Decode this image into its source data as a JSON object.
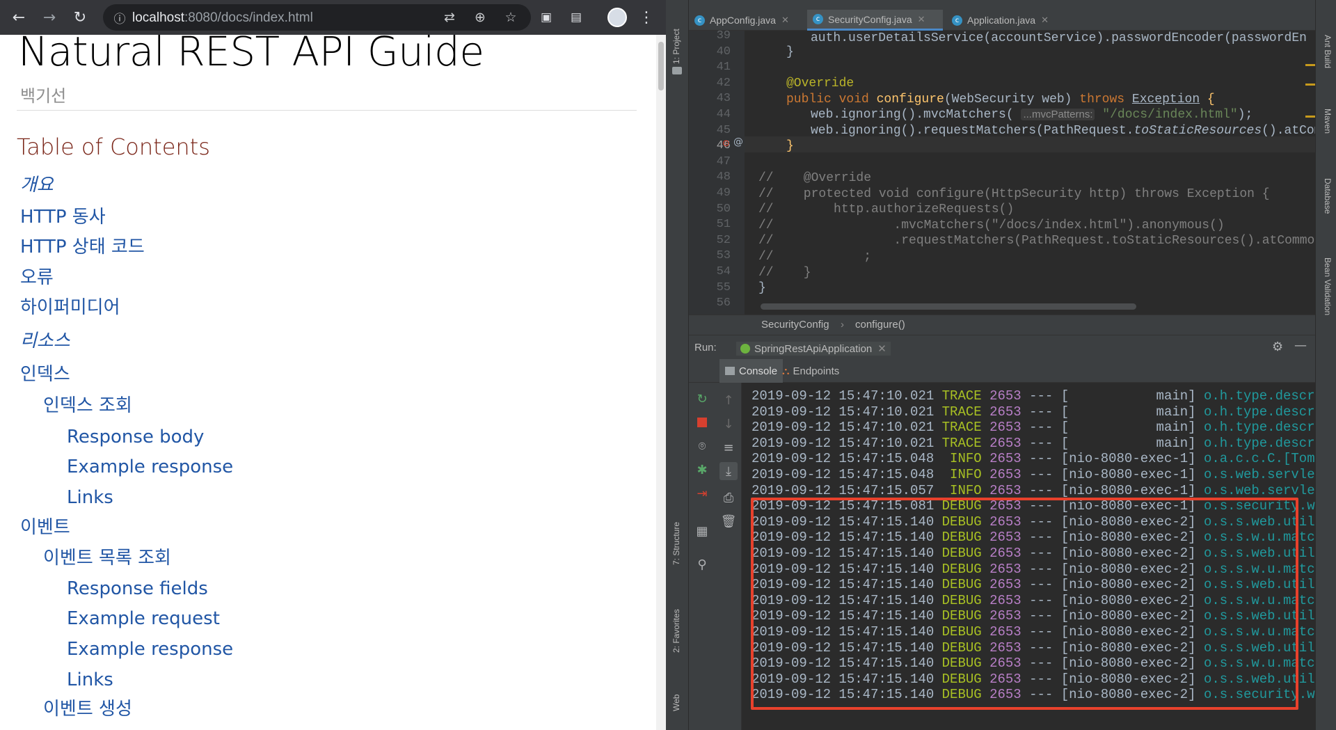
{
  "browser": {
    "url_host": "localhost",
    "url_rest": ":8080/docs/index.html",
    "doc_title": "Natural REST API Guide",
    "author": "백기선",
    "toc_title": "Table of Contents",
    "toc": [
      {
        "label": "개요",
        "level": 1,
        "italic": true
      },
      {
        "label": "HTTP 동사",
        "level": 1,
        "italic": false
      },
      {
        "label": "HTTP 상태 코드",
        "level": 1,
        "italic": false
      },
      {
        "label": "오류",
        "level": 1,
        "italic": false
      },
      {
        "label": "하이퍼미디어",
        "level": 1,
        "italic": false
      },
      {
        "label": "리소스",
        "level": 1,
        "italic": true
      },
      {
        "label": "인덱스",
        "level": 1,
        "italic": false
      },
      {
        "label": "인덱스 조회",
        "level": 2,
        "italic": false
      },
      {
        "label": "Response body",
        "level": 3,
        "italic": false
      },
      {
        "label": "Example response",
        "level": 3,
        "italic": false
      },
      {
        "label": "Links",
        "level": 3,
        "italic": false
      },
      {
        "label": "이벤트",
        "level": 1,
        "italic": false
      },
      {
        "label": "이벤트 목록 조회",
        "level": 2,
        "italic": false
      },
      {
        "label": "Response fields",
        "level": 3,
        "italic": false
      },
      {
        "label": "Example request",
        "level": 3,
        "italic": false
      },
      {
        "label": "Example response",
        "level": 3,
        "italic": false
      },
      {
        "label": "Links",
        "level": 3,
        "italic": false
      },
      {
        "label": "이벤트 생성",
        "level": 2,
        "italic": false
      }
    ]
  },
  "ide": {
    "tabs": [
      {
        "label": "AppConfig.java"
      },
      {
        "label": "SecurityConfig.java"
      },
      {
        "label": "Application.java"
      }
    ],
    "left_tools": [
      "1: Project",
      "7: Structure",
      "2: Favorites",
      "Web"
    ],
    "right_tools": [
      "Ant Build",
      "Maven",
      "Database",
      "Bean Validation"
    ],
    "line_numbers": [
      "39",
      "40",
      "41",
      "42",
      "43",
      "44",
      "45",
      "46",
      "47",
      "48",
      "49",
      "50",
      "51",
      "52",
      "53",
      "54",
      "55",
      "56"
    ],
    "code": {
      "l39": "auth.userDetailsService(accountService).passwordEncoder(passwordEn",
      "l40": "}",
      "l42_ann": "@Override",
      "l43_a": "public void ",
      "l43_fn": "configure",
      "l43_b": "(WebSecurity web) ",
      "l43_kw": "throws ",
      "l43_ex": "Exception",
      "l43_c": " {",
      "l44_a": "web.ignoring().mvcMatchers( ",
      "l44_hint": "...mvcPatterns:",
      "l44_str": "\"/docs/index.html\"",
      "l44_b": ");",
      "l45_a": "web.ignoring().requestMatchers(PathRequest.",
      "l45_it": "toStaticResources",
      "l45_b": "().atCom",
      "l46": "}",
      "l48": "//    @Override",
      "l49": "//    protected void configure(HttpSecurity http) throws Exception {",
      "l50": "//        http.authorizeRequests()",
      "l51": "//                .mvcMatchers(\"/docs/index.html\").anonymous()",
      "l52": "//                .requestMatchers(PathRequest.toStaticResources().atCommon",
      "l53": "//            ;",
      "l54": "//    }",
      "l55": "}"
    },
    "breadcrumb": [
      "SecurityConfig",
      "configure()"
    ],
    "run_label": "Run:",
    "run_config": "SpringRestApiApplication",
    "console_tab": "Console",
    "endpoints_tab": "Endpoints",
    "log": [
      {
        "ts": "2019-09-12 15:47:10.021",
        "level": "TRACE",
        "pid": "2653",
        "sep": "---",
        "thread": "[           main]",
        "logger": "o.h.type.descript"
      },
      {
        "ts": "2019-09-12 15:47:10.021",
        "level": "TRACE",
        "pid": "2653",
        "sep": "---",
        "thread": "[           main]",
        "logger": "o.h.type.descript"
      },
      {
        "ts": "2019-09-12 15:47:10.021",
        "level": "TRACE",
        "pid": "2653",
        "sep": "---",
        "thread": "[           main]",
        "logger": "o.h.type.descript"
      },
      {
        "ts": "2019-09-12 15:47:10.021",
        "level": "TRACE",
        "pid": "2653",
        "sep": "---",
        "thread": "[           main]",
        "logger": "o.h.type.descript"
      },
      {
        "ts": "2019-09-12 15:47:15.048",
        "level": " INFO",
        "pid": "2653",
        "sep": "---",
        "thread": "[nio-8080-exec-1]",
        "logger": "o.a.c.c.C.[Tomcat"
      },
      {
        "ts": "2019-09-12 15:47:15.048",
        "level": " INFO",
        "pid": "2653",
        "sep": "---",
        "thread": "[nio-8080-exec-1]",
        "logger": "o.s.web.servlet.D"
      },
      {
        "ts": "2019-09-12 15:47:15.057",
        "level": " INFO",
        "pid": "2653",
        "sep": "---",
        "thread": "[nio-8080-exec-1]",
        "logger": "o.s.web.servlet.D"
      },
      {
        "ts": "2019-09-12 15:47:15.081",
        "level": "DEBUG",
        "pid": "2653",
        "sep": "---",
        "thread": "[nio-8080-exec-1]",
        "logger": "o.s.security.web"
      },
      {
        "ts": "2019-09-12 15:47:15.140",
        "level": "DEBUG",
        "pid": "2653",
        "sep": "---",
        "thread": "[nio-8080-exec-2]",
        "logger": "o.s.s.web.util.ma"
      },
      {
        "ts": "2019-09-12 15:47:15.140",
        "level": "DEBUG",
        "pid": "2653",
        "sep": "---",
        "thread": "[nio-8080-exec-2]",
        "logger": "o.s.s.w.u.matche"
      },
      {
        "ts": "2019-09-12 15:47:15.140",
        "level": "DEBUG",
        "pid": "2653",
        "sep": "---",
        "thread": "[nio-8080-exec-2]",
        "logger": "o.s.s.web.util.ma"
      },
      {
        "ts": "2019-09-12 15:47:15.140",
        "level": "DEBUG",
        "pid": "2653",
        "sep": "---",
        "thread": "[nio-8080-exec-2]",
        "logger": "o.s.s.w.u.matche"
      },
      {
        "ts": "2019-09-12 15:47:15.140",
        "level": "DEBUG",
        "pid": "2653",
        "sep": "---",
        "thread": "[nio-8080-exec-2]",
        "logger": "o.s.s.web.util.ma"
      },
      {
        "ts": "2019-09-12 15:47:15.140",
        "level": "DEBUG",
        "pid": "2653",
        "sep": "---",
        "thread": "[nio-8080-exec-2]",
        "logger": "o.s.s.w.u.matche"
      },
      {
        "ts": "2019-09-12 15:47:15.140",
        "level": "DEBUG",
        "pid": "2653",
        "sep": "---",
        "thread": "[nio-8080-exec-2]",
        "logger": "o.s.s.web.util.ma"
      },
      {
        "ts": "2019-09-12 15:47:15.140",
        "level": "DEBUG",
        "pid": "2653",
        "sep": "---",
        "thread": "[nio-8080-exec-2]",
        "logger": "o.s.s.w.u.matche"
      },
      {
        "ts": "2019-09-12 15:47:15.140",
        "level": "DEBUG",
        "pid": "2653",
        "sep": "---",
        "thread": "[nio-8080-exec-2]",
        "logger": "o.s.s.web.util.ma"
      },
      {
        "ts": "2019-09-12 15:47:15.140",
        "level": "DEBUG",
        "pid": "2653",
        "sep": "---",
        "thread": "[nio-8080-exec-2]",
        "logger": "o.s.s.w.u.matche"
      },
      {
        "ts": "2019-09-12 15:47:15.140",
        "level": "DEBUG",
        "pid": "2653",
        "sep": "---",
        "thread": "[nio-8080-exec-2]",
        "logger": "o.s.s.web.util.ma"
      },
      {
        "ts": "2019-09-12 15:47:15.140",
        "level": "DEBUG",
        "pid": "2653",
        "sep": "---",
        "thread": "[nio-8080-exec-2]",
        "logger": "o.s.security.web"
      }
    ]
  },
  "colors": {
    "highlight_box": "#e8412c",
    "link": "#2156a5",
    "toc_title": "#7a2518"
  }
}
